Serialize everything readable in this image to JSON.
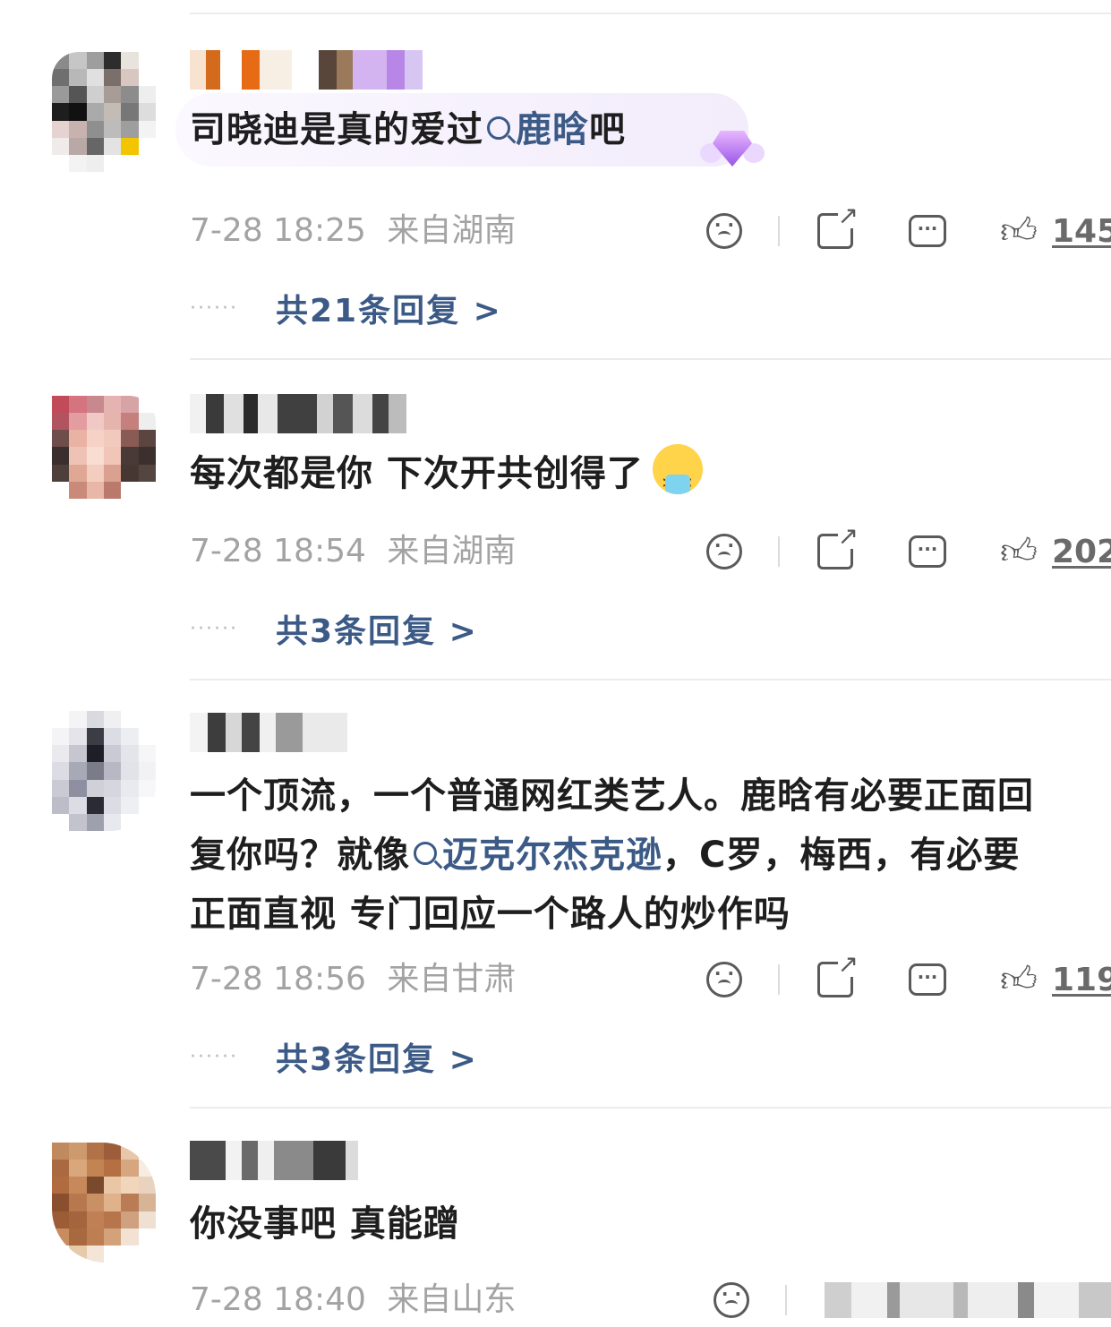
{
  "comments": [
    {
      "text_before": "司晓迪是真的爱过",
      "tag": "鹿晗",
      "text_after": "吧",
      "time": "7-28 18:25",
      "location": "来自湖南",
      "likes": "145",
      "replies": "共21条回复 >"
    },
    {
      "text": "每次都是你 下次开共创得了",
      "emoji": "hot-face-emoji",
      "time": "7-28 18:54",
      "location": "来自湖南",
      "likes": "202",
      "replies": "共3条回复 >"
    },
    {
      "line1": "一个顶流，一个普通网红类艺人。鹿晗有必要正面回",
      "line2_before": "复你吗？就像",
      "line2_tag": "迈克尔杰克逊",
      "line2_after": "，C罗，梅西，有必要",
      "line3": "正面直视 专门回应一个路人的炒作吗",
      "time": "7-28 18:56",
      "location": "来自甘肃",
      "likes": "119",
      "replies": "共3条回复 >"
    },
    {
      "text": "你没事吧 真能蹭",
      "time": "7-28 18:40",
      "location": "来自山东"
    }
  ],
  "icons": {
    "reaction": "frown-face-icon",
    "share": "share-icon",
    "comment": "comment-icon",
    "like": "thumbs-up-icon"
  },
  "colors": {
    "link": "#3c5a86",
    "meta": "#a3a3a3"
  }
}
